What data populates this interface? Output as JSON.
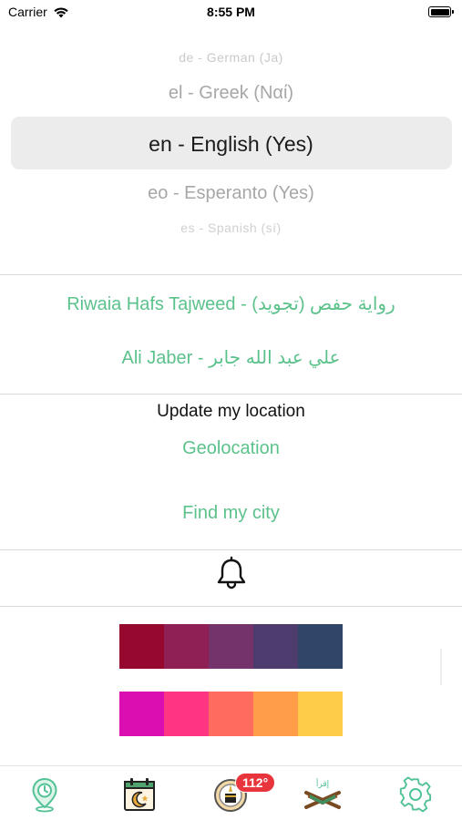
{
  "status_bar": {
    "carrier": "Carrier",
    "time": "8:55 PM"
  },
  "language_picker": {
    "items": [
      "de - German (Ja)",
      "el - Greek (Ναί)",
      "en - English (Yes)",
      "eo - Esperanto (Yes)",
      "es - Spanish (sí)"
    ],
    "selected_index": 2
  },
  "recitation": {
    "riwaia_label": "Riwaia Hafs Tajweed - (تجويد) رواية حفص",
    "reciter_label": "Ali Jaber - علي عبد الله جابر"
  },
  "location": {
    "title": "Update my location",
    "geolocation_label": "Geolocation",
    "find_city_label": "Find my city"
  },
  "notifications": {
    "icon": "bell-icon"
  },
  "themes": {
    "palette_1": [
      "#96082e",
      "#8f2055",
      "#74336a",
      "#4e3c6e",
      "#2f4668"
    ],
    "palette_2": [
      "#db0eb1",
      "#fd3582",
      "#ff6b5e",
      "#ff9d48",
      "#ffcc4a"
    ]
  },
  "tab_bar": {
    "tabs": [
      {
        "icon": "location-clock-icon"
      },
      {
        "icon": "calendar-crescent-icon"
      },
      {
        "icon": "qibla-compass-icon"
      },
      {
        "icon": "quran-read-icon"
      },
      {
        "icon": "gear-icon"
      }
    ],
    "qibla_badge": "112°",
    "quran_caption": "إقرأ"
  },
  "colors": {
    "accent_green": "#5cc28c",
    "tab_green": "#52c296",
    "badge_red": "#e8343c"
  }
}
